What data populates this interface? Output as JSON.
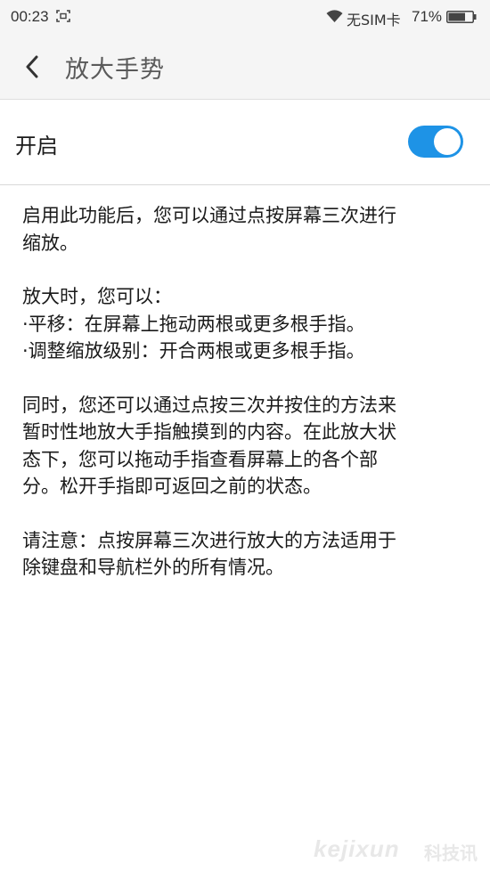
{
  "status_bar": {
    "time": "00:23",
    "sim_status": "无SIM卡",
    "battery_percent": "71%",
    "battery_level": 0.71,
    "icons": [
      "screenshot-icon",
      "wifi-icon",
      "battery-icon"
    ]
  },
  "header": {
    "back_icon": "chevron-left-icon",
    "title": "放大手势"
  },
  "toggle": {
    "label": "开启",
    "state": "on",
    "accent_color": "#1e93e6"
  },
  "content": {
    "paragraphs": [
      [
        "启用此功能后，您可以通过点按屏幕三次进行",
        "缩放。"
      ],
      [
        "放大时，您可以：",
        "·平移：在屏幕上拖动两根或更多根手指。",
        "·调整缩放级别：开合两根或更多根手指。"
      ],
      [
        "同时，您还可以通过点按三次并按住的方法来",
        "暂时性地放大手指触摸到的内容。在此放大状",
        "态下，您可以拖动手指查看屏幕上的各个部",
        "分。松开手指即可返回之前的状态。"
      ],
      [
        "请注意：点按屏幕三次进行放大的方法适用于",
        "除键盘和导航栏外的所有情况。"
      ]
    ]
  },
  "watermark": {
    "latin": "kejixun",
    "cn": "科技讯"
  }
}
